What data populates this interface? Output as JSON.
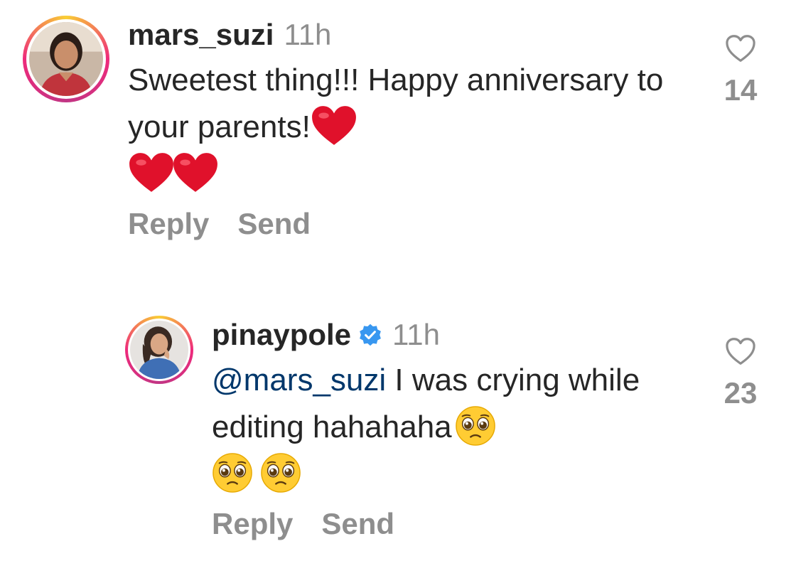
{
  "comments": [
    {
      "username": "mars_suzi",
      "time": "11h",
      "text": "Sweetest thing!!! Happy anniversary to your parents!",
      "emoji_icons": [
        "red-heart-icon",
        "red-heart-icon",
        "red-heart-icon"
      ],
      "like_count": "14",
      "actions": {
        "reply": "Reply",
        "send": "Send"
      }
    },
    {
      "username": "pinaypole",
      "verified": true,
      "time": "11h",
      "mention": "@mars_suzi",
      "text": " I was crying while editing hahahaha",
      "emoji_icons": [
        "pleading-face-icon",
        "pleading-face-icon",
        "pleading-face-icon"
      ],
      "like_count": "23",
      "actions": {
        "reply": "Reply",
        "send": "Send"
      }
    }
  ],
  "colors": {
    "text": "#262626",
    "secondary": "#8e8e8e",
    "mention": "#00376b",
    "verified": "#3897f0",
    "heart": "#e0112b"
  }
}
